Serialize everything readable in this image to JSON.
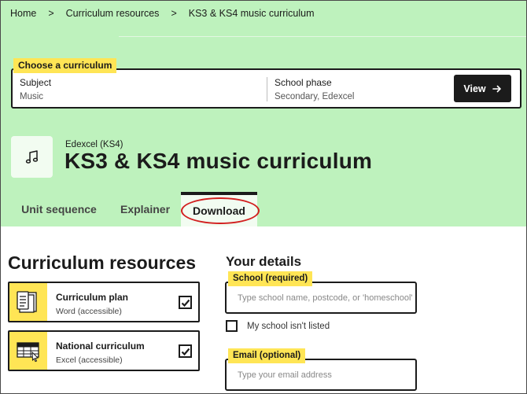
{
  "breadcrumb": {
    "items": [
      "Home",
      "Curriculum resources",
      "KS3 & KS4 music curriculum"
    ],
    "separator": ">"
  },
  "picker": {
    "label": "Choose a curriculum",
    "subject_label": "Subject",
    "subject_value": "Music",
    "phase_label": "School phase",
    "phase_value": "Secondary, Edexcel",
    "view_label": "View"
  },
  "header": {
    "icon": "music-note-icon",
    "subtitle": "Edexcel (KS4)",
    "title": "KS3 & KS4 music curriculum"
  },
  "tabs": [
    {
      "label": "Unit sequence",
      "active": false
    },
    {
      "label": "Explainer",
      "active": false
    },
    {
      "label": "Download",
      "active": true
    }
  ],
  "resources": {
    "title": "Curriculum resources",
    "items": [
      {
        "name": "Curriculum plan",
        "format": "Word (accessible)",
        "checked": true,
        "icon": "curriculum-plan-icon"
      },
      {
        "name": "National curriculum",
        "format": "Excel (accessible)",
        "checked": true,
        "icon": "spreadsheet-icon"
      }
    ]
  },
  "details": {
    "title": "Your details",
    "school_label": "School (required)",
    "school_placeholder": "Type school name, postcode, or 'homeschool'",
    "not_listed_label": "My school isn't listed",
    "email_label": "Email (optional)",
    "email_placeholder": "Type your email address"
  },
  "colors": {
    "hero_background": "#bef2bd",
    "label_highlight": "#ffe555",
    "annotation_ring": "#d21f1f"
  }
}
